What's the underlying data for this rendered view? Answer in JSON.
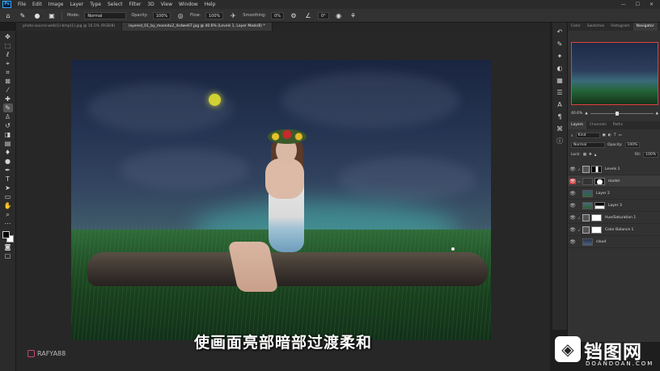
{
  "app": {
    "logo_text": "Ps",
    "menu": [
      "File",
      "Edit",
      "Image",
      "Layer",
      "Type",
      "Select",
      "Filter",
      "3D",
      "View",
      "Window",
      "Help"
    ],
    "window_controls": [
      "—",
      "☐",
      "✕"
    ]
  },
  "options_bar": {
    "mode_label": "Mode:",
    "mode_value": "Normal",
    "opacity_label": "Opacity:",
    "opacity_value": "100%",
    "flow_label": "Flow:",
    "flow_value": "100%",
    "smoothing_label": "Smoothing:",
    "smoothing_value": "0%",
    "angle_value": "0°"
  },
  "doc_tabs": [
    {
      "label": "photo-source-web(1)-bmp(1).jpg @ 16.5% (RGB/8)",
      "active": false
    },
    {
      "label": "layered_01_by_moondu2_4sdwe67.jpg @ 40.6% (Levels 1, Layer Mask/8) *",
      "active": true
    }
  ],
  "tools": [
    "move",
    "marquee",
    "lasso",
    "quick-select",
    "crop",
    "frame",
    "eyedropper",
    "healing",
    "brush",
    "stamp",
    "history-brush",
    "eraser",
    "gradient",
    "blur",
    "dodge",
    "pen",
    "type",
    "path-select",
    "shape",
    "hand",
    "zoom",
    "more"
  ],
  "canvas": {
    "subtitle": "使画面亮部暗部过渡柔和",
    "watermark": "RAFYA88"
  },
  "right_panel": {
    "nav_tabs": [
      "Color",
      "Swatches",
      "Histogram",
      "Navigator"
    ],
    "active_nav_tab": "Navigator",
    "zoom_value": "40.6%",
    "layers_tabs": [
      "Layers",
      "Channels",
      "Paths"
    ],
    "active_layers_tab": "Layers",
    "kind_label": "Kind",
    "blend_mode": "Normal",
    "opacity_label": "Opacity:",
    "opacity_value": "100%",
    "lock_label": "Lock:",
    "fill_label": "Fill:",
    "fill_value": "100%",
    "layers": [
      {
        "name": "Levels 1",
        "type": "adjustment",
        "active": false,
        "eye_red": false
      },
      {
        "name": "model",
        "type": "pixel",
        "active": true,
        "eye_red": true
      },
      {
        "name": "Layer 2",
        "type": "pixel",
        "active": false,
        "eye_red": false
      },
      {
        "name": "Layer 3",
        "type": "pixel",
        "active": false,
        "eye_red": false
      },
      {
        "name": "Hue/Saturation 1",
        "type": "adjustment",
        "active": false,
        "eye_red": false
      },
      {
        "name": "Color Balance 1",
        "type": "adjustment",
        "active": false,
        "eye_red": false
      },
      {
        "name": "cloud",
        "type": "pixel",
        "active": false,
        "eye_red": false
      }
    ]
  },
  "site_logo": {
    "text": "铛图网",
    "sub": "DOANDOAN.COM",
    "glyph": "◈"
  }
}
